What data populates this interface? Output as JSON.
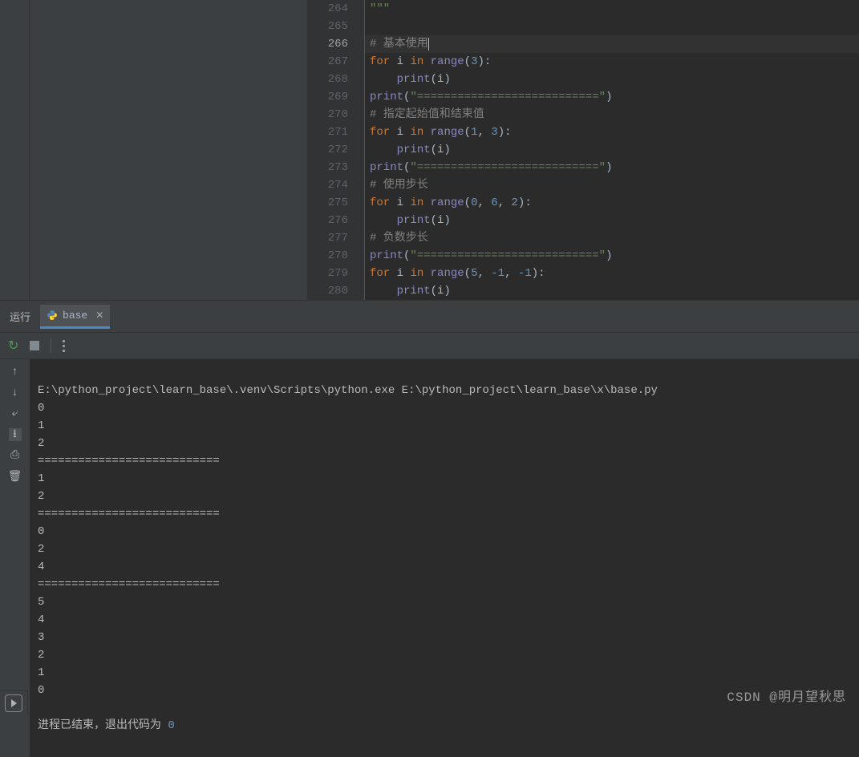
{
  "editor": {
    "gutter": [
      "264",
      "265",
      "266",
      "267",
      "268",
      "269",
      "270",
      "271",
      "272",
      "273",
      "274",
      "275",
      "276",
      "277",
      "278",
      "279",
      "280"
    ],
    "current_line": "266",
    "lines": {
      "l264": "\"\"\"",
      "comment_basic": "# 基本使用",
      "for1_i": "i",
      "range1_arg": "3",
      "print_i_a": "(i)",
      "sep_str": "\"===========================\"",
      "comment_start_end": "# 指定起始值和结束值",
      "range2_a": "1",
      "range2_b": "3",
      "comment_step": "# 使用步长",
      "range3_a": "0",
      "range3_b": "6",
      "range3_c": "2",
      "comment_neg": "# 负数步长",
      "range4_a": "5",
      "range4_b": "-1",
      "range4_c": "-1",
      "kw_for": "for",
      "kw_in": "in",
      "fn_range": "range",
      "fn_print": "print"
    }
  },
  "run": {
    "panel_label": "运行",
    "tab_name": "base"
  },
  "console": {
    "command": "E:\\python_project\\learn_base\\.venv\\Scripts\\python.exe E:\\python_project\\learn_base\\x\\base.py",
    "lines": [
      "0",
      "1",
      "2",
      "===========================",
      "1",
      "2",
      "===========================",
      "0",
      "2",
      "4",
      "===========================",
      "5",
      "4",
      "3",
      "2",
      "1",
      "0"
    ],
    "exit_prefix": "进程已结束，退出代码为 ",
    "exit_code": "0"
  },
  "watermark": "CSDN @明月望秋思"
}
